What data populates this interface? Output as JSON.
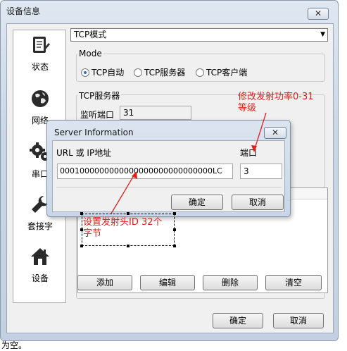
{
  "window": {
    "title": "设备信息",
    "close_glyph": "✕"
  },
  "sidebar": {
    "items": [
      {
        "label": "状态",
        "icon": "status-document-icon"
      },
      {
        "label": "网络",
        "icon": "globe-icon"
      },
      {
        "label": "串口",
        "icon": "gears-icon"
      },
      {
        "label": "套接字",
        "icon": "wrench-icon"
      },
      {
        "label": "设备",
        "icon": "house-icon"
      }
    ]
  },
  "mode_select": {
    "value": "TCP模式",
    "arrow": "▼"
  },
  "mode_group": {
    "title": "Mode",
    "options": [
      {
        "label": "TCP自动",
        "selected": true
      },
      {
        "label": "TCP服务器",
        "selected": false
      },
      {
        "label": "TCP客户端",
        "selected": false
      }
    ]
  },
  "server_group": {
    "title": "TCP服务器",
    "listen_port_label": "监听端口",
    "listen_port_value": "31"
  },
  "list_buttons": {
    "add": "添加",
    "edit": "编辑",
    "delete": "删除",
    "clear": "清空"
  },
  "footer": {
    "ok": "确定",
    "cancel": "取消"
  },
  "dialog": {
    "title": "Server Information",
    "close_glyph": "✕",
    "url_label": "URL 或 IP地址",
    "url_value": "0001000000000000000000000000000LC",
    "port_label": "端口",
    "port_value": "3",
    "ok": "确定",
    "cancel": "取消"
  },
  "annotations": {
    "power": "修改发射功率0-31",
    "power_line2": "等级",
    "id": "设置发射头ID 32个",
    "id_line2": "字节"
  },
  "bottom_text": "为空。",
  "colors": {
    "annotation": "#e0201c",
    "radio_on": "#2a6fcf"
  }
}
